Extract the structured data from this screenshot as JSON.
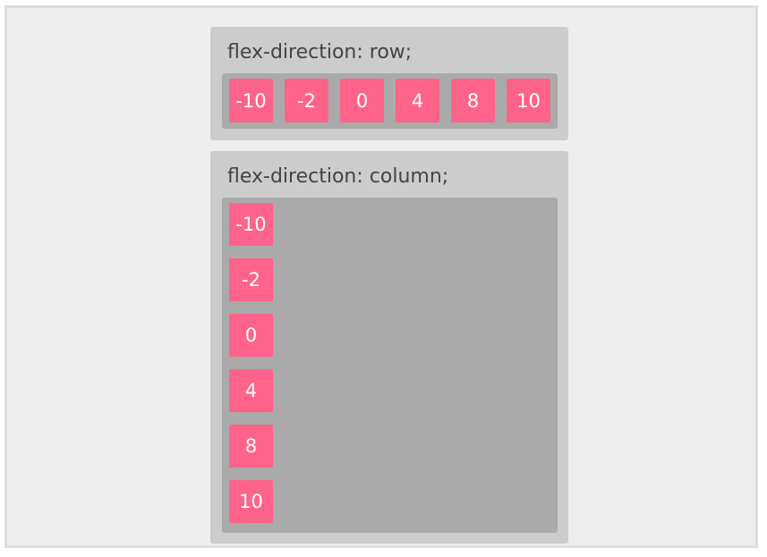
{
  "row_panel": {
    "title": "flex-direction: row;",
    "items": [
      "-10",
      "-2",
      "0",
      "4",
      "8",
      "10"
    ]
  },
  "column_panel": {
    "title": "flex-direction: column;",
    "items": [
      "-10",
      "-2",
      "0",
      "4",
      "8",
      "10"
    ]
  },
  "colors": {
    "page_background": "#eeeeee",
    "panel_background": "#cccccc",
    "container_background": "#aaaaaa",
    "item_background": "#ff638a",
    "item_text": "#ffffff",
    "title_text": "#444444"
  }
}
